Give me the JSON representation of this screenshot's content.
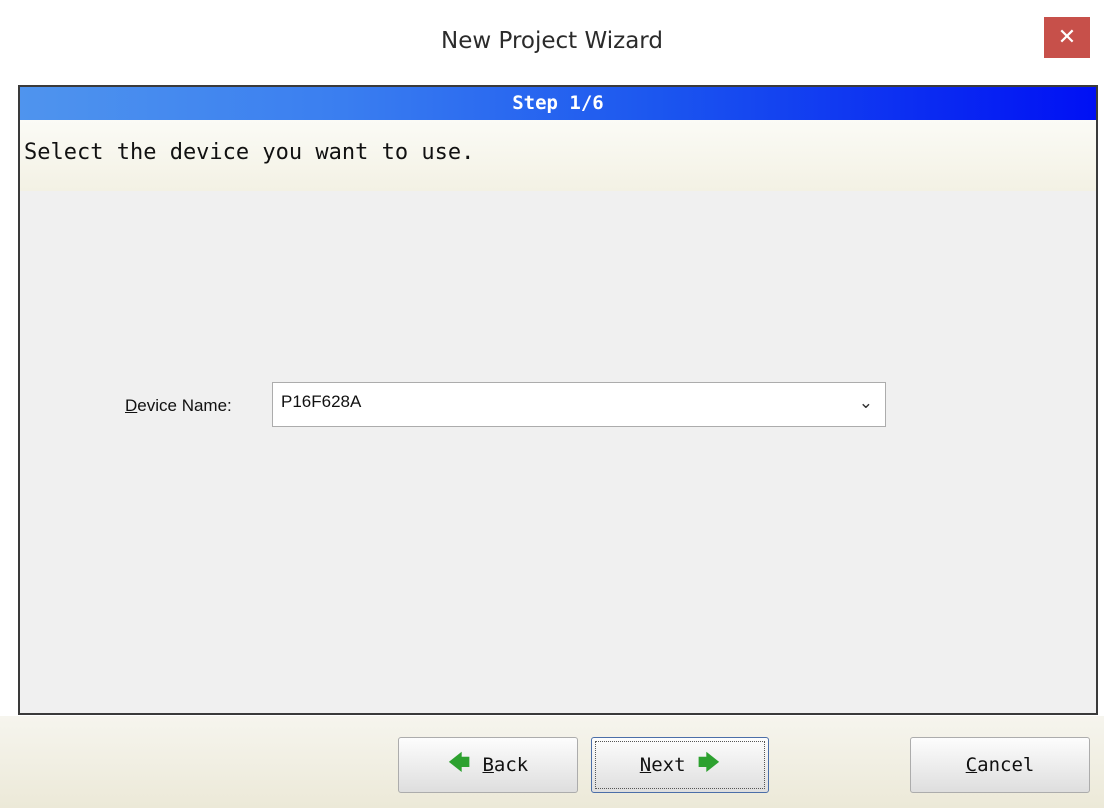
{
  "window": {
    "title": "New Project Wizard",
    "close_glyph": "✕"
  },
  "wizard": {
    "step_label": "Step 1/6",
    "instruction": "Select the device you want to use."
  },
  "device": {
    "label_mnemonic": "D",
    "label_rest": "evice Name:",
    "selected_value": "P16F628A",
    "dropdown_icon": "chevron-down-icon"
  },
  "buttons": {
    "back": {
      "mnemonic": "B",
      "rest": "ack"
    },
    "next": {
      "mnemonic": "N",
      "rest": "ext"
    },
    "cancel": {
      "mnemonic": "C",
      "rest": "ancel"
    }
  },
  "colors": {
    "step_band_start": "#4f94ee",
    "step_band_end": "#0010f4",
    "close_button": "#c7504a",
    "nav_arrow": "#2da12f"
  }
}
